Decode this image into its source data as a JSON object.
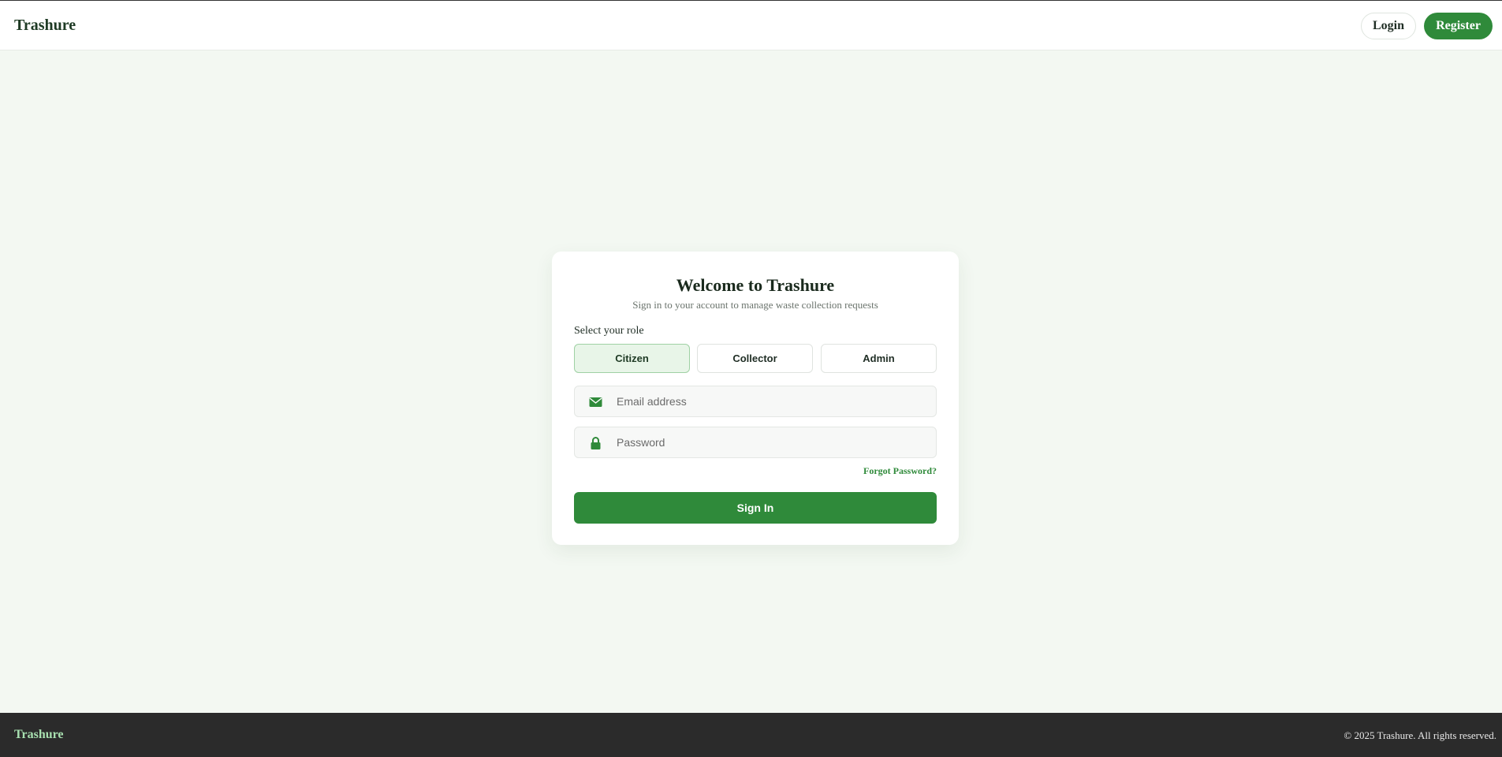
{
  "header": {
    "brand": "Trashure",
    "login_label": "Login",
    "register_label": "Register"
  },
  "login_card": {
    "title": "Welcome to Trashure",
    "subtitle": "Sign in to your account to manage waste collection requests",
    "role_label": "Select your role",
    "roles": [
      {
        "label": "Citizen",
        "selected": true
      },
      {
        "label": "Collector",
        "selected": false
      },
      {
        "label": "Admin",
        "selected": false
      }
    ],
    "email": {
      "placeholder": "Email address",
      "value": "",
      "icon": "envelope-icon"
    },
    "password": {
      "placeholder": "Password",
      "value": "",
      "icon": "lock-icon"
    },
    "forgot_label": "Forgot Password?",
    "submit_label": "Sign In"
  },
  "footer": {
    "brand": "Trashure",
    "copyright": "© 2025 Trashure. All rights reserved."
  },
  "colors": {
    "brand_green": "#2f8a3a",
    "page_background": "#f3f8f2",
    "footer_background": "#2b2b2b",
    "selected_role_background": "#e8f5e8"
  }
}
